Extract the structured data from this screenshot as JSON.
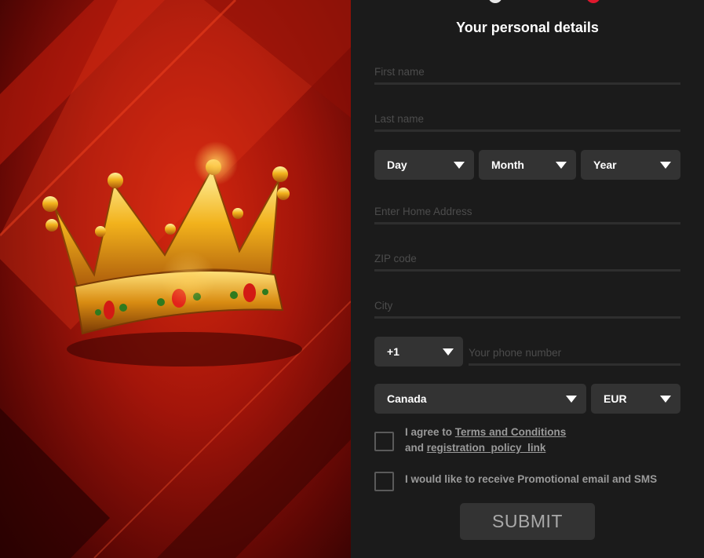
{
  "hero": {
    "image": "crown-illustration"
  },
  "form": {
    "title": "Your personal details",
    "first_name": {
      "placeholder": "First name",
      "value": ""
    },
    "last_name": {
      "placeholder": "Last name",
      "value": ""
    },
    "birth": {
      "day": "Day",
      "month": "Month",
      "year": "Year"
    },
    "address": {
      "placeholder": "Enter Home Address",
      "value": ""
    },
    "zip": {
      "placeholder": "ZIP code",
      "value": ""
    },
    "city": {
      "placeholder": "City",
      "value": ""
    },
    "phone": {
      "code": "+1",
      "placeholder": "Your phone number",
      "value": ""
    },
    "country": "Canada",
    "currency": "EUR",
    "terms": {
      "prefix": "I agree to",
      "link1": "Terms and Conditions",
      "middle": "and",
      "link2": "registration_policy_link"
    },
    "promo": "I would like to receive Promotional email and SMS",
    "submit": "SUBMIT"
  },
  "colors": {
    "accent": "#e0182d",
    "panel": "#1b1b1b",
    "control": "#333333"
  }
}
